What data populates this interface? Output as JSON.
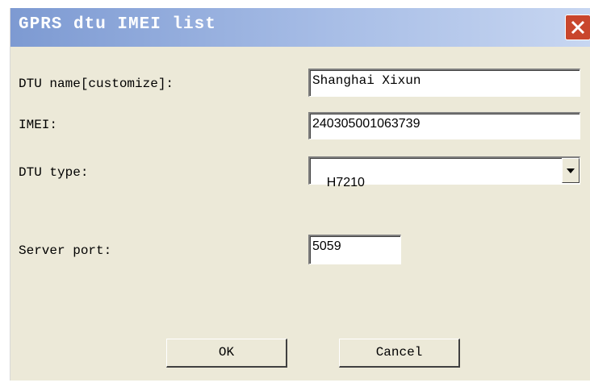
{
  "window": {
    "title": "GPRS dtu IMEI list",
    "close_icon": "close-icon"
  },
  "form": {
    "dtu_name": {
      "label": "DTU name[customize]:",
      "value": "Shanghai Xixun"
    },
    "imei": {
      "label": "IMEI:",
      "value": "240305001063739"
    },
    "dtu_type": {
      "label": "DTU type:",
      "selected": "H7210"
    },
    "server_port": {
      "label": "Server port:",
      "value": "5059"
    }
  },
  "buttons": {
    "ok_label": "OK",
    "cancel_label": "Cancel"
  },
  "colors": {
    "titlebar_start": "#7d9ad2",
    "titlebar_end": "#c7d6f1",
    "close_button": "#c9462c",
    "dialog_background": "#ece9d8"
  }
}
